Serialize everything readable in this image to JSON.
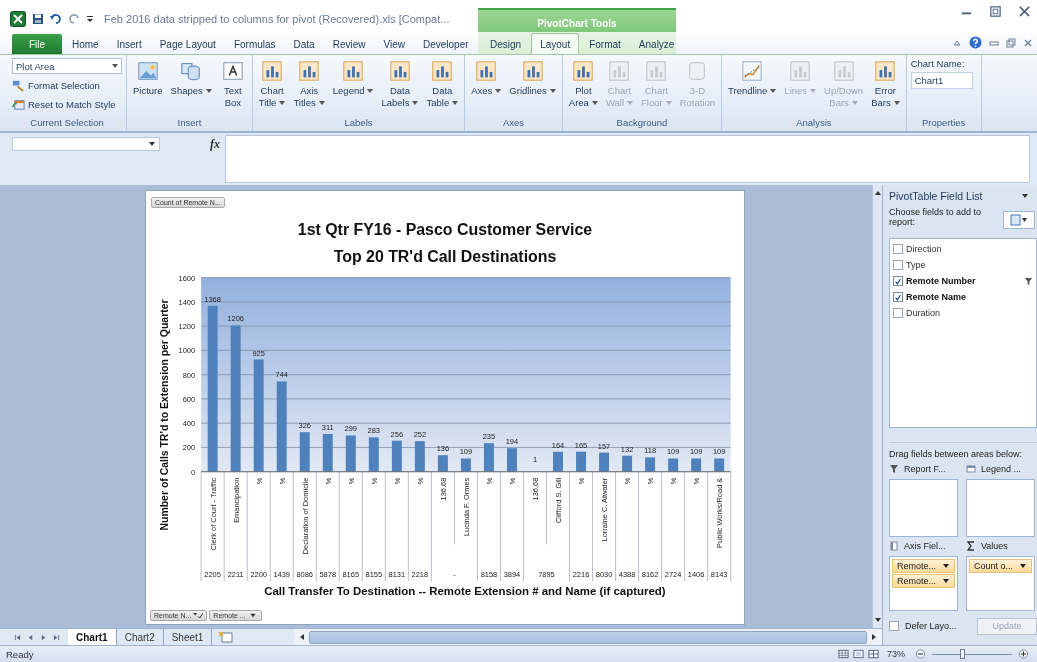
{
  "window": {
    "title": "Feb 2016 data stripped to columns for pivot (Recovered).xls  [Compat...",
    "contextual_group": "PivotChart Tools"
  },
  "ribbon_tabs": [
    {
      "label": "File",
      "kind": "file",
      "selected": false
    },
    {
      "label": "Home",
      "kind": "standard",
      "selected": false
    },
    {
      "label": "Insert",
      "kind": "standard",
      "selected": false
    },
    {
      "label": "Page Layout",
      "kind": "standard",
      "selected": false
    },
    {
      "label": "Formulas",
      "kind": "standard",
      "selected": false
    },
    {
      "label": "Data",
      "kind": "standard",
      "selected": false
    },
    {
      "label": "Review",
      "kind": "standard",
      "selected": false
    },
    {
      "label": "View",
      "kind": "standard",
      "selected": false
    },
    {
      "label": "Developer",
      "kind": "standard",
      "selected": false
    },
    {
      "label": "Design",
      "kind": "contextual",
      "selected": false
    },
    {
      "label": "Layout",
      "kind": "contextual",
      "selected": true
    },
    {
      "label": "Format",
      "kind": "contextual",
      "selected": false
    },
    {
      "label": "Analyze",
      "kind": "contextual",
      "selected": false
    }
  ],
  "ribbon_groups": [
    {
      "label": "Current Selection",
      "kind": "selection",
      "dropdown": "Plot Area",
      "commands": [
        "Format Selection",
        "Reset to Match Style"
      ]
    },
    {
      "label": "Insert",
      "kind": "insert",
      "items": [
        {
          "label": "Picture",
          "dropdown": false,
          "disabled": false
        },
        {
          "label": "Shapes",
          "dropdown": true,
          "disabled": false
        },
        {
          "label": "Text Box",
          "dropdown": false,
          "disabled": false
        }
      ]
    },
    {
      "label": "Labels",
      "kind": "chart",
      "items": [
        {
          "label": "Chart Title",
          "dropdown": true,
          "disabled": false
        },
        {
          "label": "Axis Titles",
          "dropdown": true,
          "disabled": false
        },
        {
          "label": "Legend",
          "dropdown": true,
          "disabled": false
        },
        {
          "label": "Data Labels",
          "dropdown": true,
          "disabled": false
        },
        {
          "label": "Data Table",
          "dropdown": true,
          "disabled": false
        }
      ]
    },
    {
      "label": "Axes",
      "kind": "chart",
      "items": [
        {
          "label": "Axes",
          "dropdown": true,
          "disabled": false
        },
        {
          "label": "Gridlines",
          "dropdown": true,
          "disabled": false
        }
      ]
    },
    {
      "label": "Background",
      "kind": "background",
      "items": [
        {
          "label": "Plot Area",
          "dropdown": true,
          "disabled": false
        },
        {
          "label": "Chart Wall",
          "dropdown": true,
          "disabled": true
        },
        {
          "label": "Chart Floor",
          "dropdown": true,
          "disabled": true
        },
        {
          "label": "3-D Rotation",
          "dropdown": false,
          "disabled": true
        }
      ]
    },
    {
      "label": "Analysis",
      "kind": "analysis",
      "items": [
        {
          "label": "Trendline",
          "dropdown": true,
          "disabled": false
        },
        {
          "label": "Lines",
          "dropdown": true,
          "disabled": true
        },
        {
          "label": "Up/Down Bars",
          "dropdown": true,
          "disabled": true
        },
        {
          "label": "Error Bars",
          "dropdown": true,
          "disabled": false
        }
      ]
    },
    {
      "label": "Properties",
      "kind": "properties",
      "field_label": "Chart Name:",
      "value": "Chart1"
    }
  ],
  "formula_bar": {
    "function_label": "fx"
  },
  "chart": {
    "values_button": "Count of Remote N...",
    "axis_buttons": [
      {
        "label": "Remote N...",
        "filtered": true
      },
      {
        "label": "Remote ...",
        "filtered": false
      }
    ],
    "chart_data": {
      "type": "bar",
      "title": "1st Qtr FY16 - Pasco Customer Service",
      "subtitle": "Top 20 TR'd Call Destinations",
      "xlabel": "Call Transfer To Destination -- Remote Extension # and Name (if captured)",
      "ylabel": "Number of Calls TR'd to Extension per Quarter",
      "grid": true,
      "categories": [
        "Clerk of Court - Traffic",
        "Emancipation",
        "%",
        "%",
        "Declaration of Domicile",
        "%",
        "%",
        "%",
        "%",
        "%",
        "136.68",
        "Lucinda F. Ormes",
        "%",
        "%",
        "136.68",
        "Clifford S. Gill",
        "%",
        "Lorraine C. Atwater",
        "%",
        "%",
        "%",
        "%",
        "Public Works/Road &"
      ],
      "values": [
        1368,
        1206,
        925,
        744,
        326,
        311,
        299,
        283,
        256,
        252,
        136,
        109,
        235,
        194,
        1,
        164,
        165,
        157,
        132,
        118,
        109,
        109,
        109
      ],
      "ylim": [
        0,
        1600
      ],
      "yticks": [
        0,
        200,
        400,
        600,
        800,
        1000,
        1200,
        1400,
        1600
      ],
      "data_labels": true
    },
    "category_groups": [
      {
        "label": "2205",
        "merged": false
      },
      {
        "label": "2211",
        "merged": false
      },
      {
        "label": "2200",
        "merged": false
      },
      {
        "label": "1439",
        "merged": false
      },
      {
        "label": "8086",
        "merged": false
      },
      {
        "label": "5878",
        "merged": false
      },
      {
        "label": "8165",
        "merged": false
      },
      {
        "label": "8155",
        "merged": false
      },
      {
        "label": "8131",
        "merged": false
      },
      {
        "label": "2218",
        "merged": false
      },
      {
        "label": "-",
        "merged": true
      },
      {
        "label": "8158",
        "merged": false
      },
      {
        "label": "3894",
        "merged": false
      },
      {
        "label": "7895",
        "merged": true
      },
      {
        "label": "2216",
        "merged": false
      },
      {
        "label": "8030",
        "merged": false
      },
      {
        "label": "4388",
        "merged": false
      },
      {
        "label": "8162",
        "merged": false
      },
      {
        "label": "2724",
        "merged": false
      },
      {
        "label": "1406",
        "merged": false
      },
      {
        "label": "8143",
        "merged": false
      }
    ]
  },
  "field_list": {
    "title": "PivotTable Field List",
    "prompt": "Choose fields to add to report:",
    "fields": [
      {
        "label": "Direction",
        "checked": false,
        "filtered": false
      },
      {
        "label": "Type",
        "checked": false,
        "filtered": false
      },
      {
        "label": "Remote Number",
        "checked": true,
        "filtered": true
      },
      {
        "label": "Remote Name",
        "checked": true,
        "filtered": false
      },
      {
        "label": "Duration",
        "checked": false,
        "filtered": false
      }
    ],
    "areas_prompt": "Drag fields between areas below:",
    "areas": [
      {
        "kind": "filter",
        "label": "Report F..."
      },
      {
        "kind": "legend",
        "label": "Legend ..."
      },
      {
        "kind": "axis",
        "label": "Axis Fiel...",
        "items": [
          "Remote...",
          "Remote..."
        ]
      },
      {
        "kind": "values",
        "label": "Values",
        "items": [
          "Count o..."
        ]
      }
    ],
    "defer_label": "Defer Layo...",
    "defer_checked": false,
    "update_label": "Update",
    "update_disabled": true
  },
  "sheet_tabs": [
    {
      "label": "Chart1",
      "selected": true
    },
    {
      "label": "Chart2",
      "selected": false
    },
    {
      "label": "Sheet1",
      "selected": false
    }
  ],
  "status_bar": {
    "status": "Ready",
    "zoom": "73%",
    "level": 0.38
  }
}
